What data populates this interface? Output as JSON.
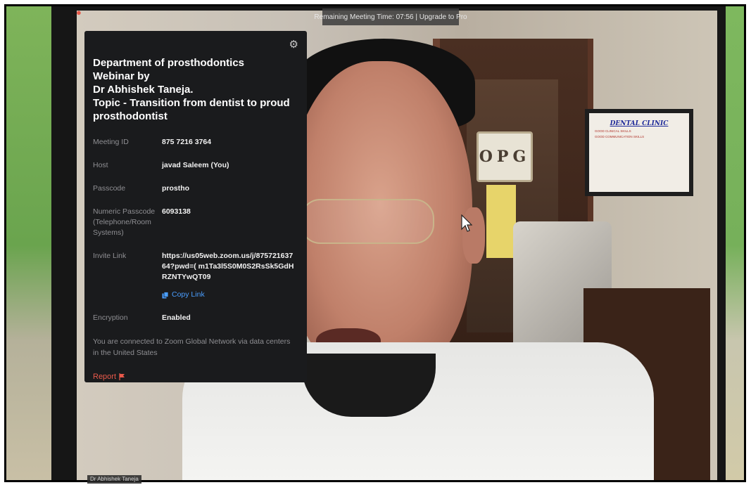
{
  "top_banner": {
    "text": "Remaining Meeting Time: 07:56 | Upgrade to Pro"
  },
  "meeting_info": {
    "title": "Department of prosthodontics\n Webinar by\n  Dr Abhishek Taneja.\n Topic - Transition from dentist to proud\n prosthodontist",
    "rows": [
      {
        "label": "Meeting ID",
        "value": "875 7216 3764"
      },
      {
        "label": "Host",
        "value": "javad Saleem (You)"
      },
      {
        "label": "Passcode",
        "value": "prostho"
      },
      {
        "label": "Numeric Passcode (Telephone/Room Systems)",
        "value": "6093138"
      }
    ],
    "invite_label": "Invite Link",
    "invite_url": "https://us05web.zoom.us/j/87572163764?pwd=( m1Ta3l5S0M0S2RsSk5GdHRZNTYwQT09",
    "copy_link_label": "Copy Link",
    "encryption_label": "Encryption",
    "encryption_value": "Enabled",
    "network_note": "You are connected to Zoom Global Network via data centers in the United States",
    "report_label": "Report"
  },
  "background": {
    "opg_sign": "OPG",
    "wall_frame_title": "DENTAL CLINIC",
    "wall_frame_lines": [
      "GOOD CLINICAL SKILLS",
      "GOOD COMMUNICATION SKILLS"
    ]
  },
  "participant": {
    "name_tag": "Dr Abhishek Taneja"
  },
  "icons": [
    "zoom-logo-icon",
    "settings-gear-icon",
    "copy-link-icon",
    "report-flag-icon",
    "mouse-cursor-icon"
  ],
  "colors": {
    "panel_bg": "#1a1b1d",
    "link_blue": "#4a9eff",
    "report_red": "#e8594a"
  }
}
